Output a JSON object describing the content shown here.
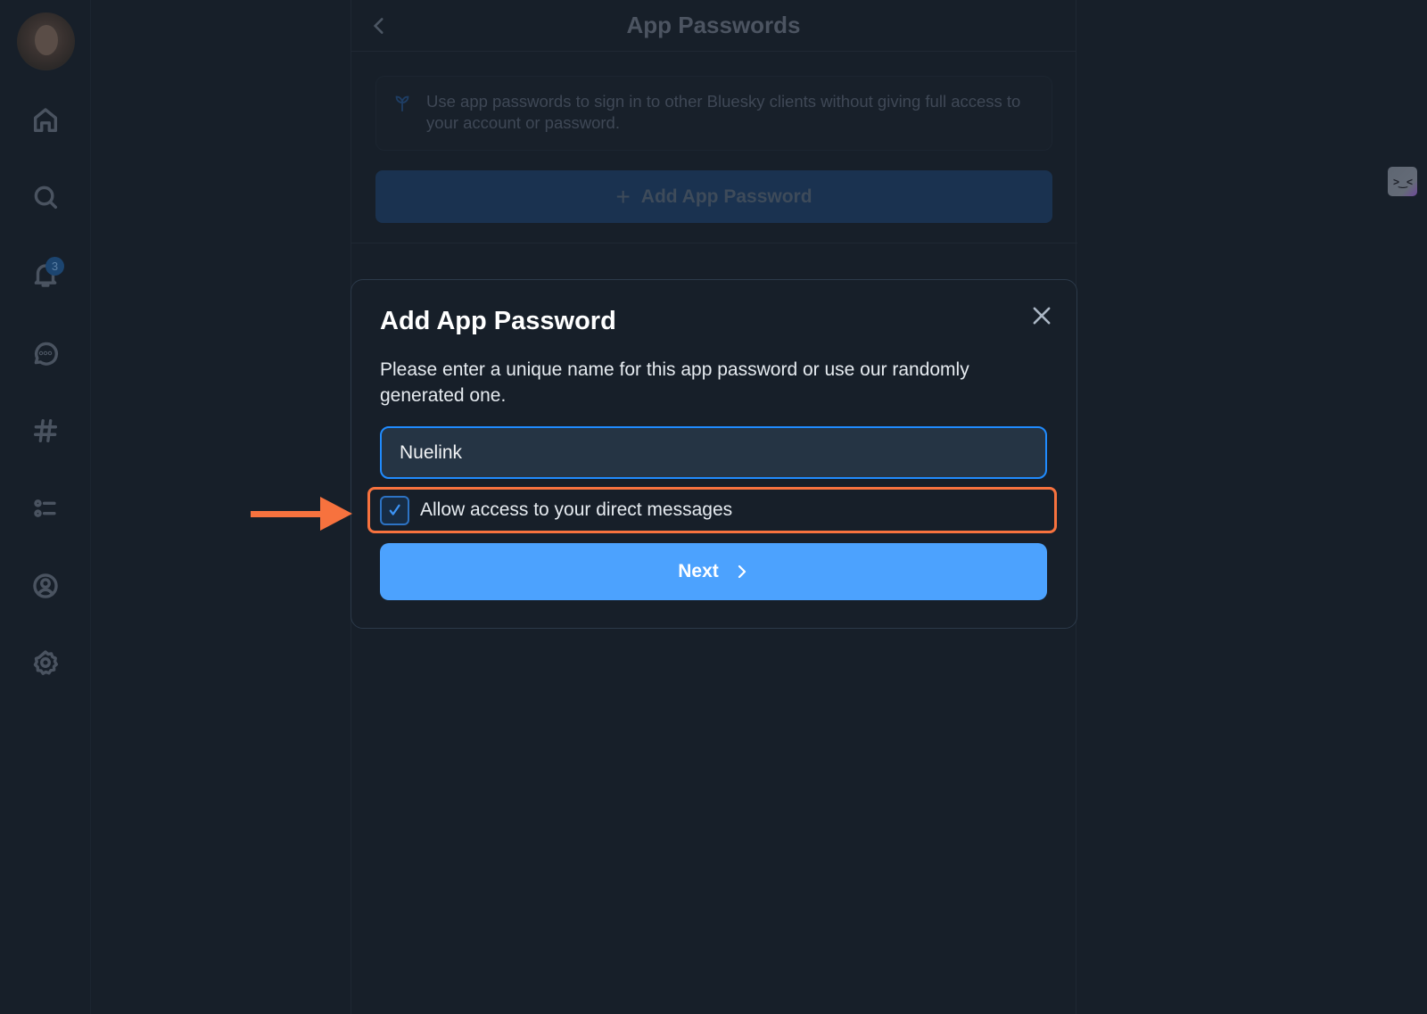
{
  "sidebar": {
    "avatar_alt": "User avatar",
    "items": [
      {
        "name": "home",
        "icon": "home-icon"
      },
      {
        "name": "search",
        "icon": "search-icon"
      },
      {
        "name": "notifications",
        "icon": "bell-icon",
        "badge": "3"
      },
      {
        "name": "chat",
        "icon": "chat-icon"
      },
      {
        "name": "feeds",
        "icon": "hash-icon"
      },
      {
        "name": "lists",
        "icon": "list-icon"
      },
      {
        "name": "profile",
        "icon": "user-circle-icon"
      },
      {
        "name": "settings",
        "icon": "gear-icon"
      }
    ]
  },
  "header": {
    "title": "App Passwords",
    "back_icon": "chevron-left-icon"
  },
  "info": {
    "icon": "sprout-icon",
    "text": "Use app passwords to sign in to other Bluesky clients without giving full access to your account or password."
  },
  "add_button": {
    "icon": "plus-icon",
    "label": "Add App Password"
  },
  "dialog": {
    "title": "Add App Password",
    "close_icon": "close-icon",
    "description": "Please enter a unique name for this app password or use our randomly generated one.",
    "name_input_value": "Nuelink",
    "checkbox_label": "Allow access to your direct messages",
    "checkbox_checked": true,
    "next_label": "Next",
    "next_icon": "chevron-right-icon"
  },
  "annotation": {
    "arrow_color": "#f7723e",
    "highlight_color": "#f7723e"
  },
  "floating_widget": {
    "glyph": ">‿<"
  },
  "colors": {
    "background": "#171f29",
    "accent": "#4ca2fe",
    "input_border": "#208bfe"
  }
}
